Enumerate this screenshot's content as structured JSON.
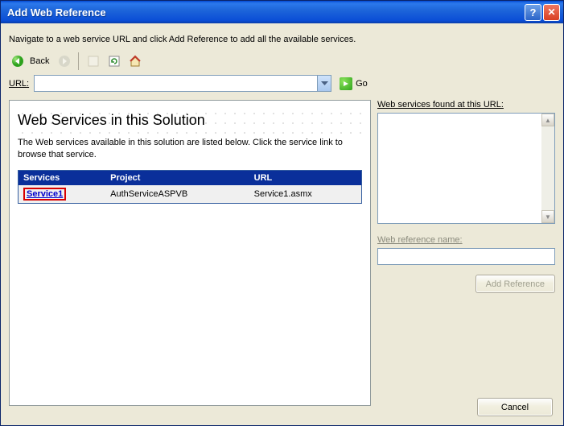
{
  "title": "Add Web Reference",
  "instruction": "Navigate to a web service URL and click Add Reference to add all the available services.",
  "toolbar": {
    "back_label": "Back",
    "go_label": "Go"
  },
  "url": {
    "label": "URL:",
    "value": ""
  },
  "browser": {
    "heading": "Web Services in this Solution",
    "description": "The Web services available in this solution are listed below. Click the service link to browse that service.",
    "columns": [
      "Services",
      "Project",
      "URL"
    ],
    "rows": [
      {
        "service": "Service1",
        "project": "AuthServiceASPVB",
        "url": "Service1.asmx"
      }
    ]
  },
  "right": {
    "found_label": "Web services found at this URL:",
    "ref_name_label": "Web reference name:",
    "ref_name_value": "",
    "add_ref_label": "Add Reference"
  },
  "footer": {
    "cancel_label": "Cancel"
  }
}
